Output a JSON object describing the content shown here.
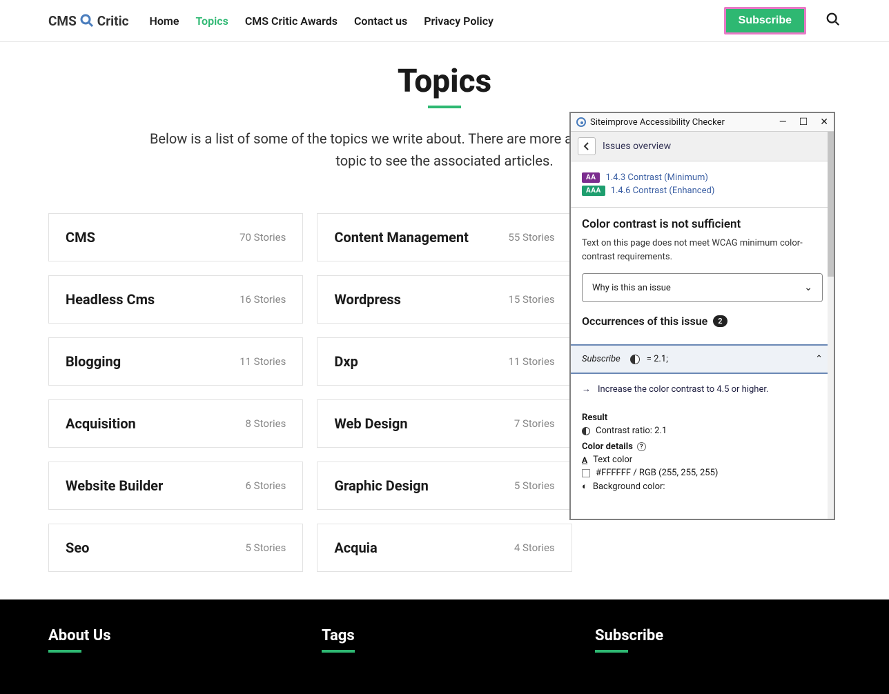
{
  "header": {
    "logo_pre": "CMS",
    "logo_post": "Critic",
    "nav": [
      "Home",
      "Topics",
      "CMS Critic Awards",
      "Contact us",
      "Privacy Policy"
    ],
    "active_index": 1,
    "subscribe_label": "Subscribe"
  },
  "page": {
    "title": "Topics",
    "intro": "Below is a list of some of the topics we write about. There are more added regularly. Click on any topic to see the associated articles."
  },
  "topics": [
    {
      "name": "CMS",
      "count": "70 Stories"
    },
    {
      "name": "Content Management",
      "count": "55 Stories"
    },
    {
      "name": "Headless Cms",
      "count": "16 Stories"
    },
    {
      "name": "Wordpress",
      "count": "15 Stories"
    },
    {
      "name": "Blogging",
      "count": "11 Stories"
    },
    {
      "name": "Dxp",
      "count": "11 Stories"
    },
    {
      "name": "Acquisition",
      "count": "8 Stories"
    },
    {
      "name": "Web Design",
      "count": "7 Stories"
    },
    {
      "name": "Website Builder",
      "count": "6 Stories"
    },
    {
      "name": "Graphic Design",
      "count": "5 Stories"
    },
    {
      "name": "Seo",
      "count": "5 Stories"
    },
    {
      "name": "Acquia",
      "count": "4 Stories"
    }
  ],
  "footer": {
    "about_title": "About Us",
    "tags_title": "Tags",
    "subscribe_title": "Subscribe"
  },
  "a11y": {
    "window_title": "Siteimprove Accessibility Checker",
    "back_label": "Issues overview",
    "rules": [
      {
        "badge": "AA",
        "text": "1.4.3 Contrast (Minimum)"
      },
      {
        "badge": "AAA",
        "text": "1.4.6 Contrast (Enhanced)"
      }
    ],
    "issue_title": "Color contrast is not sufficient",
    "issue_desc": "Text on this page does not meet WCAG minimum color-contrast requirements.",
    "why_label": "Why is this an issue",
    "occurrences_label": "Occurrences of this issue",
    "occurrences_count": "2",
    "occurrence_item_text": "Subscribe",
    "occurrence_item_value": "= 2.1;",
    "suggestion": "Increase the color contrast to 4.5 or higher.",
    "result_heading": "Result",
    "contrast_label": "Contrast ratio: 2.1",
    "color_details_heading": "Color details",
    "text_color_label": "Text color",
    "text_color_value": "#FFFFFF / RGB (255, 255, 255)",
    "bg_color_label": "Background color:"
  }
}
